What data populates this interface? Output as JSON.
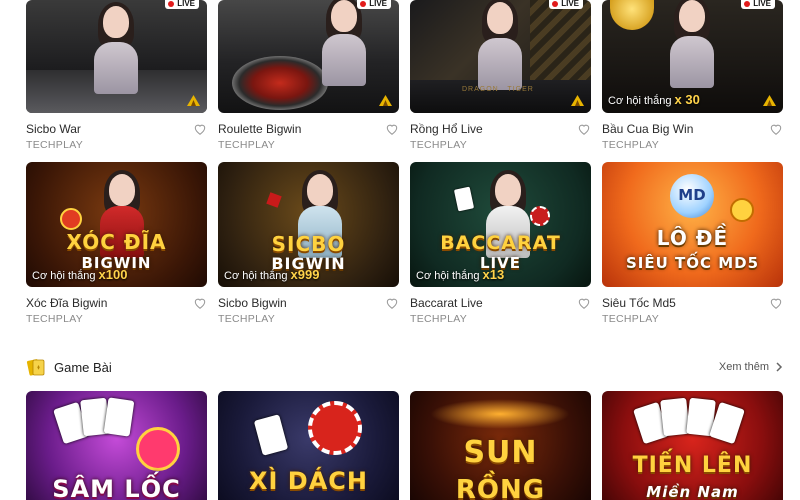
{
  "colors": {
    "live_badge_dot": "#e21b1b",
    "gold_text": "#ffd23f",
    "section_icon": "#e6b400"
  },
  "row1": [
    {
      "title": "Sicbo War",
      "provider": "TECHPLAY",
      "live": "LIVE"
    },
    {
      "title": "Roulette Bigwin",
      "provider": "TECHPLAY",
      "live": "LIVE"
    },
    {
      "title": "Rồng Hổ Live",
      "provider": "TECHPLAY",
      "live": "LIVE",
      "table_text": "DRAGON   TIGER"
    },
    {
      "title": "Bầu Cua Big Win",
      "provider": "TECHPLAY",
      "live": "LIVE",
      "promo": "Cơ hội thắng",
      "promo_mult": "x 30"
    }
  ],
  "row2": [
    {
      "title": "Xóc Đĩa Bigwin",
      "provider": "TECHPLAY",
      "art_line1": "XÓC ĐĨA",
      "art_line2": "BIGWIN",
      "promo": "Cơ hội thắng",
      "promo_mult": "x100"
    },
    {
      "title": "Sicbo Bigwin",
      "provider": "TECHPLAY",
      "art_line1": "SICBO",
      "art_line2": "BIGWIN",
      "promo": "Cơ hội thắng",
      "promo_mult": "x999"
    },
    {
      "title": "Baccarat Live",
      "provider": "TECHPLAY",
      "art_line1": "BACCARAT",
      "art_line2": "LIVE",
      "promo": "Cơ hội thắng",
      "promo_mult": "x13"
    },
    {
      "title": "Siêu Tốc Md5",
      "provider": "TECHPLAY",
      "art_badge": "MD",
      "art_line1": "LÔ ĐỀ",
      "art_line2": "SIÊU TỐC MD5"
    }
  ],
  "section": {
    "title": "Game Bài",
    "see_more": "Xem thêm"
  },
  "row3": [
    {
      "art_line1": "SÂM LỐC"
    },
    {
      "art_line1": "XÌ DÁCH"
    },
    {
      "art_line1": "SUN",
      "art_line2": "RỒNG"
    },
    {
      "art_line1": "TIẾN LÊN",
      "art_line2": "Miền Nam"
    }
  ]
}
